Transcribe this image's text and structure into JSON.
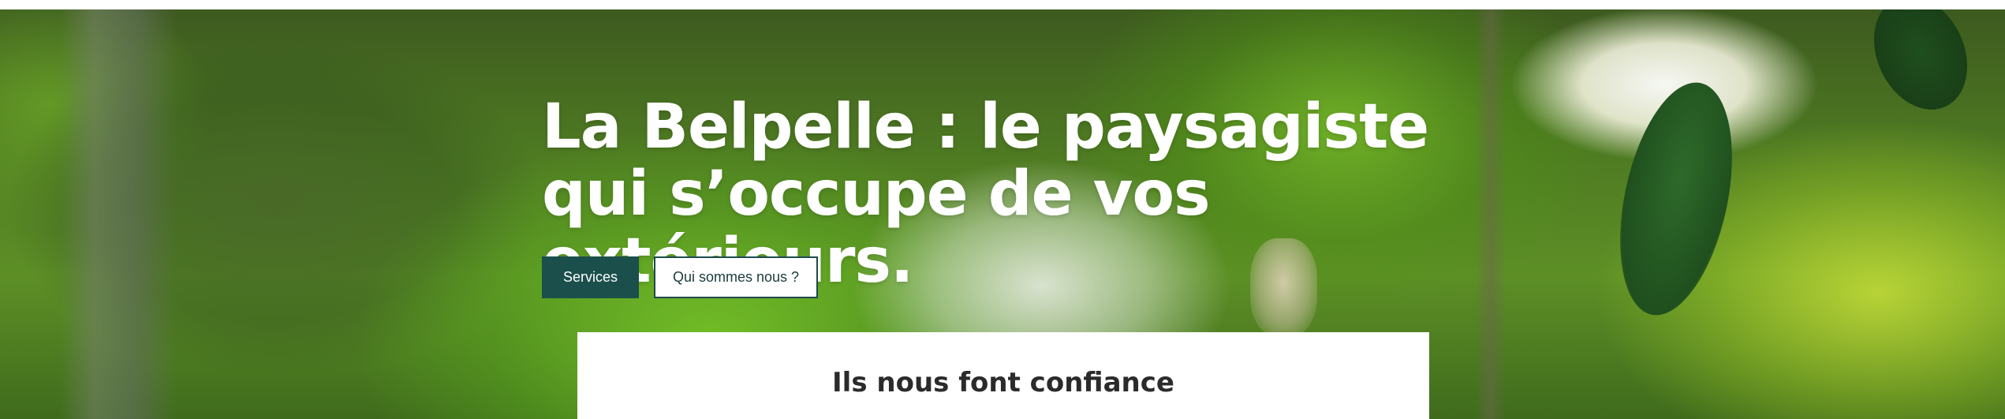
{
  "hero": {
    "title": "La Belpelle : le paysagiste qui s’occupe de vos extérieurs.",
    "buttons": {
      "primary_label": "Services",
      "secondary_label": "Qui sommes nous ?"
    }
  },
  "trust": {
    "title": "Ils nous font confiance"
  },
  "colors": {
    "primary_button": "#1b4f4c",
    "secondary_border": "#1d4a4f",
    "hero_text": "#ffffff"
  }
}
